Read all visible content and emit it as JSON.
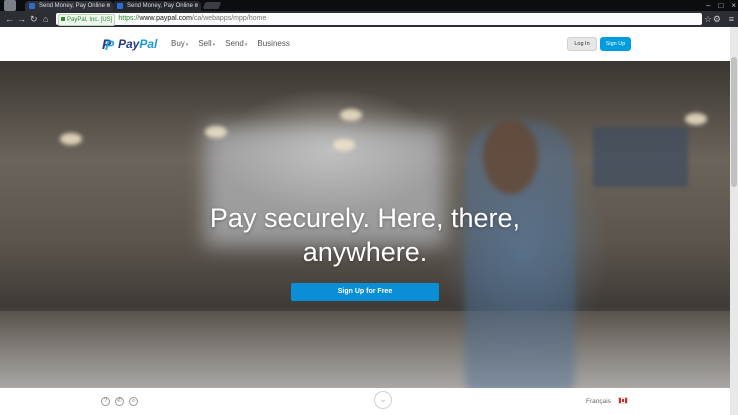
{
  "browser": {
    "tabs": [
      {
        "title": "Send Money, Pay Online o"
      },
      {
        "title": "Send Money, Pay Online o"
      }
    ],
    "tab_close": "×",
    "window_controls": [
      "–",
      "□",
      "×"
    ],
    "nav": {
      "back": "←",
      "forward": "→",
      "reload": "↻",
      "home": "⌂"
    },
    "address": {
      "security_label": "PayPal, Inc. [US]",
      "scheme": "https://",
      "host": "www.paypal.com",
      "path": "/ca/webapps/mpp/home"
    },
    "icons": [
      "wrench-icon",
      "star-icon",
      "menu-icon"
    ]
  },
  "header": {
    "logo_pay": "Pay",
    "logo_pal": "Pal",
    "logo_mark": "P",
    "nav_items": [
      {
        "label": "Buy",
        "caret": "▾"
      },
      {
        "label": "Sell",
        "caret": "▾"
      },
      {
        "label": "Send",
        "caret": "▾"
      },
      {
        "label": "Business",
        "caret": ""
      }
    ],
    "login_label": "Log In",
    "signup_label": "Sign Up"
  },
  "hero": {
    "headline_line1": "Pay securely. Here, there,",
    "headline_line2": "anywhere.",
    "cta_label": "Sign Up for Free"
  },
  "footer": {
    "icons": [
      "?",
      "✆",
      "⌕"
    ],
    "scroll_glyph": "⌄",
    "language": "Français"
  },
  "colors": {
    "paypal_dark": "#253b80",
    "paypal_light": "#179bd7",
    "cta_blue": "#0a8fd6",
    "signup_blue": "#009cde"
  }
}
